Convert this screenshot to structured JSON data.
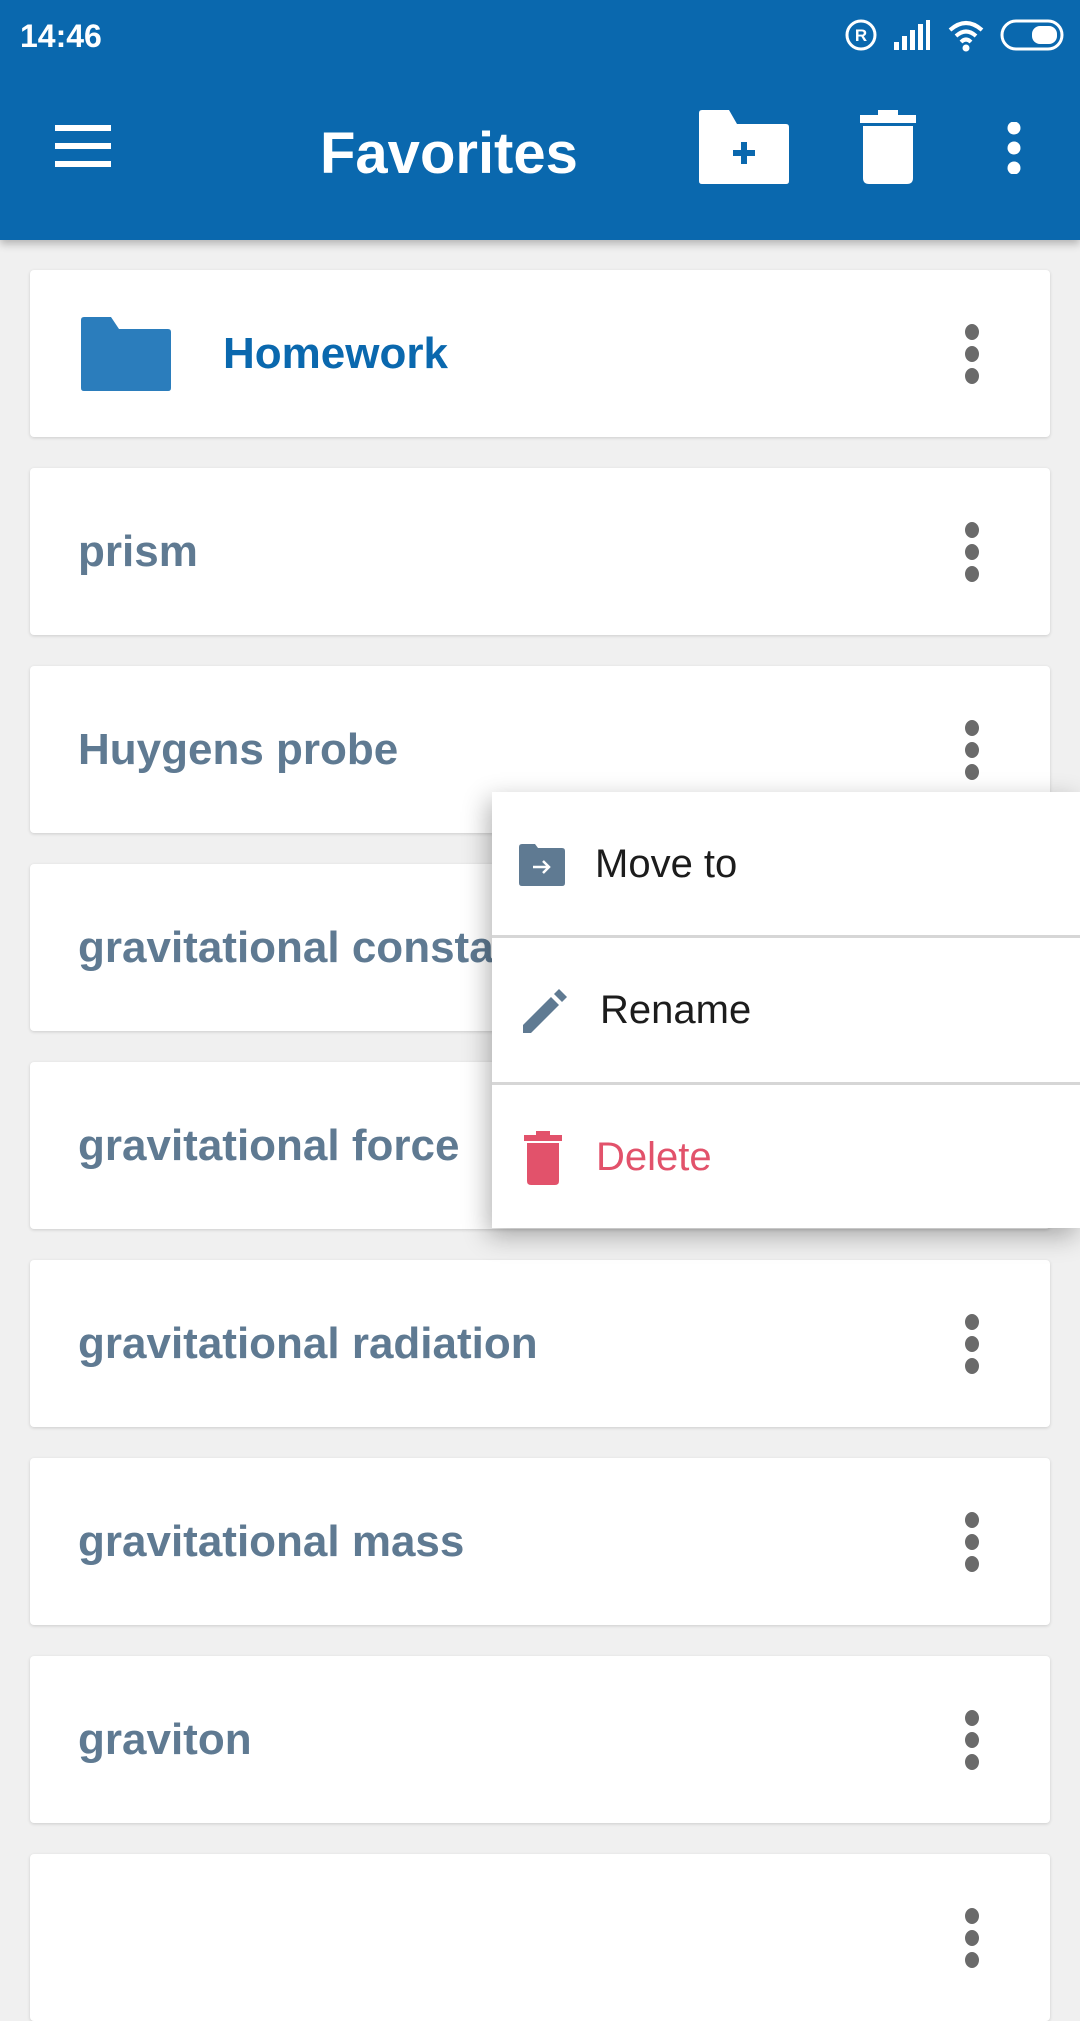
{
  "status_bar": {
    "time": "14:46",
    "icons": [
      "registered-icon",
      "signal-icon",
      "wifi-icon",
      "battery-icon"
    ]
  },
  "app_bar": {
    "title": "Favorites",
    "actions": [
      "menu-icon",
      "new-folder-icon",
      "delete-icon",
      "more-vert-icon"
    ]
  },
  "list": {
    "items": [
      {
        "label": "Homework",
        "type": "folder"
      },
      {
        "label": "prism",
        "type": "item"
      },
      {
        "label": "Huygens probe",
        "type": "item"
      },
      {
        "label": "gravitational consta",
        "type": "item"
      },
      {
        "label": "gravitational force",
        "type": "item"
      },
      {
        "label": "gravitational radiation",
        "type": "item"
      },
      {
        "label": "gravitational mass",
        "type": "item"
      },
      {
        "label": "graviton",
        "type": "item"
      },
      {
        "label": "",
        "type": "item"
      }
    ]
  },
  "context_menu": {
    "items": [
      {
        "label": "Move to",
        "icon": "move-to-folder-icon"
      },
      {
        "label": "Rename",
        "icon": "pencil-icon"
      },
      {
        "label": "Delete",
        "icon": "trash-icon"
      }
    ]
  },
  "colors": {
    "primary": "#0a68ae",
    "item_text": "#5f7a92",
    "folder": "#2b7dbc",
    "danger": "#e2526b",
    "menu_icon": "#5f7a92"
  }
}
